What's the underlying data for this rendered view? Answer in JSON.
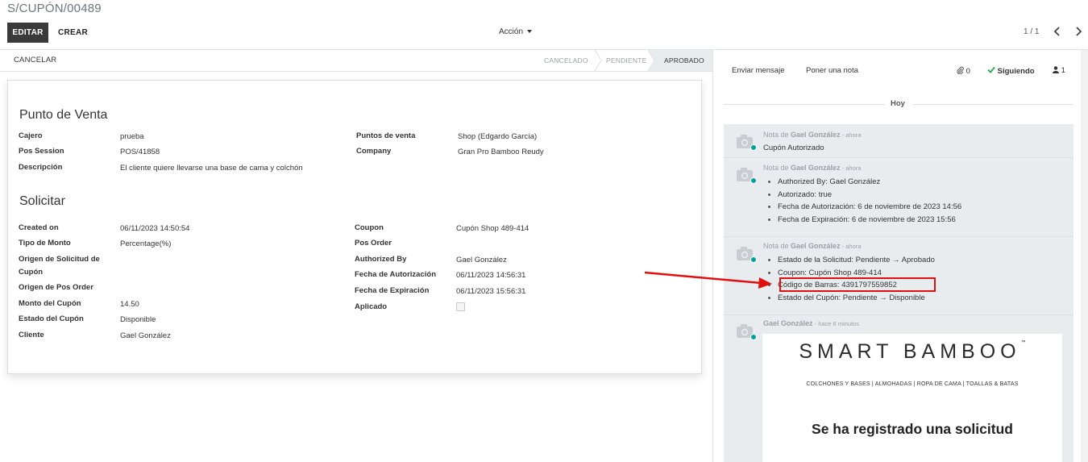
{
  "breadcrumb": "S/CUPÓN/00489",
  "buttons": {
    "edit": "EDITAR",
    "create": "CREAR",
    "action": "Acción",
    "cancel": "CANCELAR"
  },
  "pager": {
    "value": "1 / 1"
  },
  "statusbar": {
    "stages": [
      "CANCELADO",
      "PENDIENTE",
      "APROBADO"
    ],
    "active": "APROBADO"
  },
  "form": {
    "group1": {
      "title": "Punto de Venta",
      "left": [
        {
          "label": "Cajero",
          "value": "prueba"
        },
        {
          "label": "Pos Session",
          "value": "POS/41858"
        },
        {
          "label": "Descripción",
          "value": "El cliente quiere llevarse una base de cama y colchón"
        }
      ],
      "right": [
        {
          "label": "Puntos de venta",
          "value": "Shop (Edgardo García)"
        },
        {
          "label": "Company",
          "value": "Gran Pro Bamboo Reudy"
        }
      ]
    },
    "group2": {
      "title": "Solicitar",
      "left": [
        {
          "label": "Created on",
          "value": "06/11/2023 14:50:54"
        },
        {
          "label": "Tipo de Monto",
          "value": "Percentage(%)"
        },
        {
          "label": "Origen de Solicitud de Cupón",
          "value": ""
        },
        {
          "label": "Origen de Pos Order",
          "value": ""
        },
        {
          "label": "Monto del Cupón",
          "value": "14.50"
        },
        {
          "label": "Estado del Cupón",
          "value": "Disponible"
        },
        {
          "label": "Cliente",
          "value": "Gael González"
        }
      ],
      "right": [
        {
          "label": "Coupon",
          "value": "Cupón Shop 489-414"
        },
        {
          "label": "Pos Order",
          "value": ""
        },
        {
          "label": "Authorized By",
          "value": "Gael González"
        },
        {
          "label": "Fecha de Autorización",
          "value": "06/11/2023 14:56:31"
        },
        {
          "label": "Fecha de Expiración",
          "value": "06/11/2023 15:56:31"
        },
        {
          "label": "Aplicado",
          "value": ""
        }
      ],
      "aplicado_checked": false
    }
  },
  "chatter": {
    "send_message": "Enviar mensaje",
    "log_note": "Poner una nota",
    "attachments": "0",
    "following": "Siguiendo",
    "followers": "1",
    "day": "Hoy",
    "messages": [
      {
        "note": "Nota de",
        "author": "Gael González",
        "sep": " - ",
        "when": "ahora",
        "body": "Cupón Autorizado",
        "items": []
      },
      {
        "note": "Nota de",
        "author": "Gael González",
        "sep": " - ",
        "when": "ahora",
        "body": "",
        "items": [
          "Authorized By: Gael González",
          "Autorizado: true",
          "Fecha de Autorización: 6 de noviembre de 2023 14:56",
          "Fecha de Expiración: 6 de noviembre de 2023 15:56"
        ]
      },
      {
        "note": "Nota de",
        "author": "Gael González",
        "sep": " - ",
        "when": "ahora",
        "body": "",
        "items": [
          "Estado de la Solicitud: Pendiente → Aprobado",
          "Coupon: Cupón Shop 489-414",
          "Código de Barras: 4391797559852",
          "Estado del Cupón: Pendiente → Disponible"
        ]
      },
      {
        "note": "",
        "author": "Gael González",
        "sep": " - ",
        "when": "hace 6 minutos",
        "body": "",
        "items": []
      }
    ],
    "email": {
      "brand": "SMART BAMBOO",
      "brand_mark": "™",
      "tagline": "COLCHONES Y BASES | ALMOHADAS | ROPA DE CAMA | TOALLAS & BATAS",
      "heading": "Se ha registrado una solicitud"
    }
  },
  "colors": {
    "accent": "#00a09d",
    "annotation": "#e01010",
    "dark_button": "#3a3a3a"
  },
  "icons": [
    "paperclip-icon",
    "check-icon",
    "user-icon",
    "camera-avatar-icon",
    "chevron-left-icon",
    "chevron-right-icon",
    "caret-down-icon"
  ]
}
